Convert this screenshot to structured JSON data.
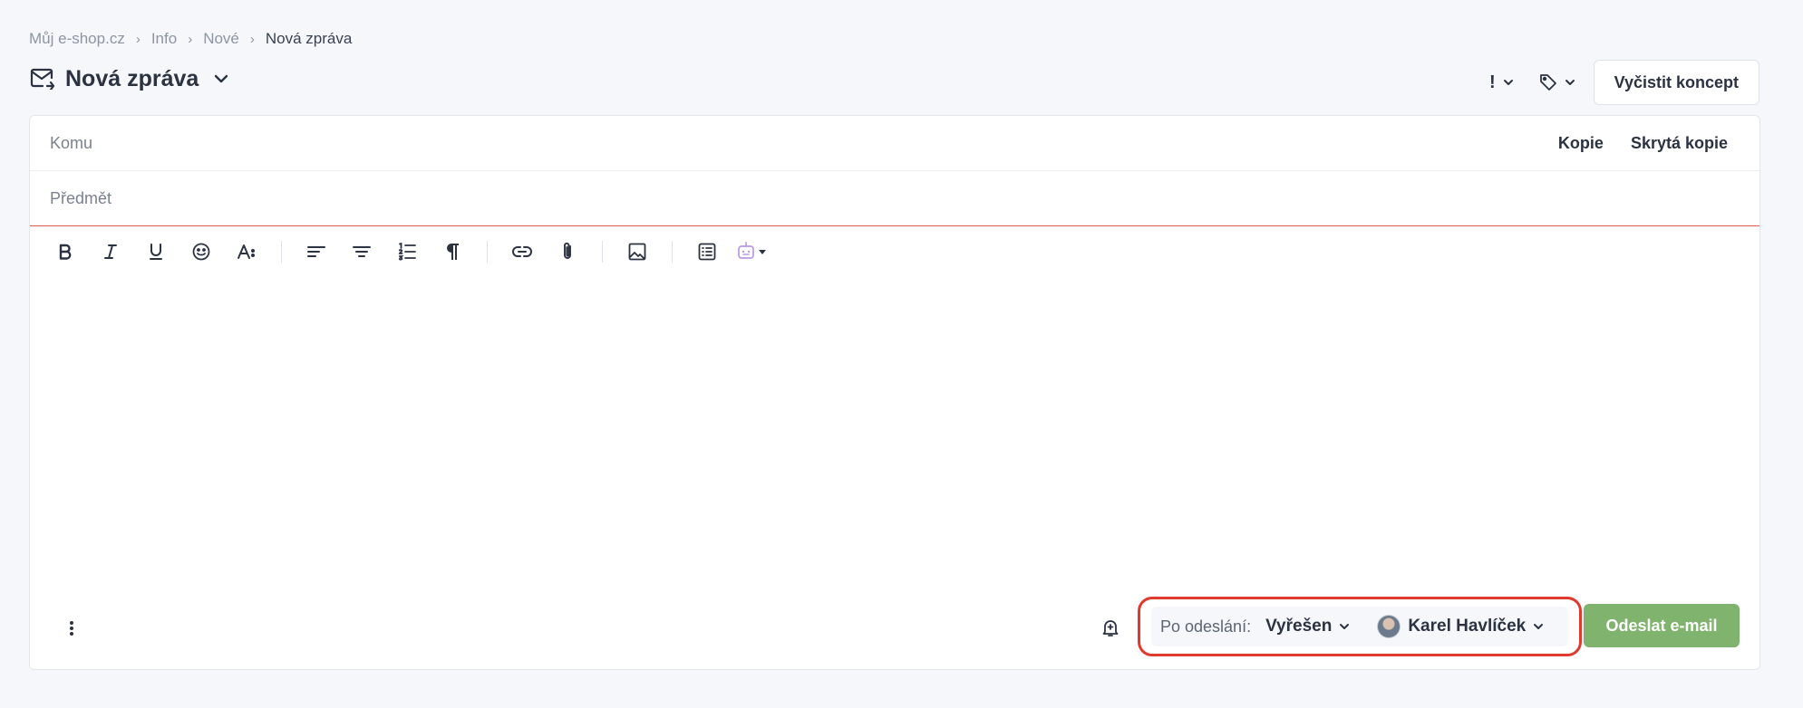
{
  "breadcrumb": {
    "items": [
      "Můj e-shop.cz",
      "Info",
      "Nové"
    ],
    "current": "Nová zpráva",
    "separator": "›"
  },
  "header": {
    "title": "Nová zpráva",
    "priority_icon": "!",
    "clear_draft_label": "Vyčistit koncept"
  },
  "compose": {
    "to_placeholder": "Komu",
    "subject_placeholder": "Předmět",
    "cc_label": "Kopie",
    "bcc_label": "Skrytá kopie"
  },
  "toolbar": {
    "buttons": [
      "bold-icon",
      "italic-icon",
      "underline-icon",
      "emoji-icon",
      "font-size-icon",
      "align-left-icon",
      "align-center-icon",
      "ordered-list-icon",
      "paragraph-icon",
      "link-icon",
      "attachment-icon",
      "image-icon",
      "template-icon",
      "ai-assistant-icon"
    ]
  },
  "footer": {
    "after_send_label": "Po odeslání:",
    "status_value": "Vyřešen",
    "assignee_name": "Karel Havlíček",
    "send_label": "Odeslat e-mail"
  },
  "colors": {
    "accent_send": "#7fb36e",
    "highlight_border": "#e0392d",
    "subject_underline": "#e05a4f"
  }
}
